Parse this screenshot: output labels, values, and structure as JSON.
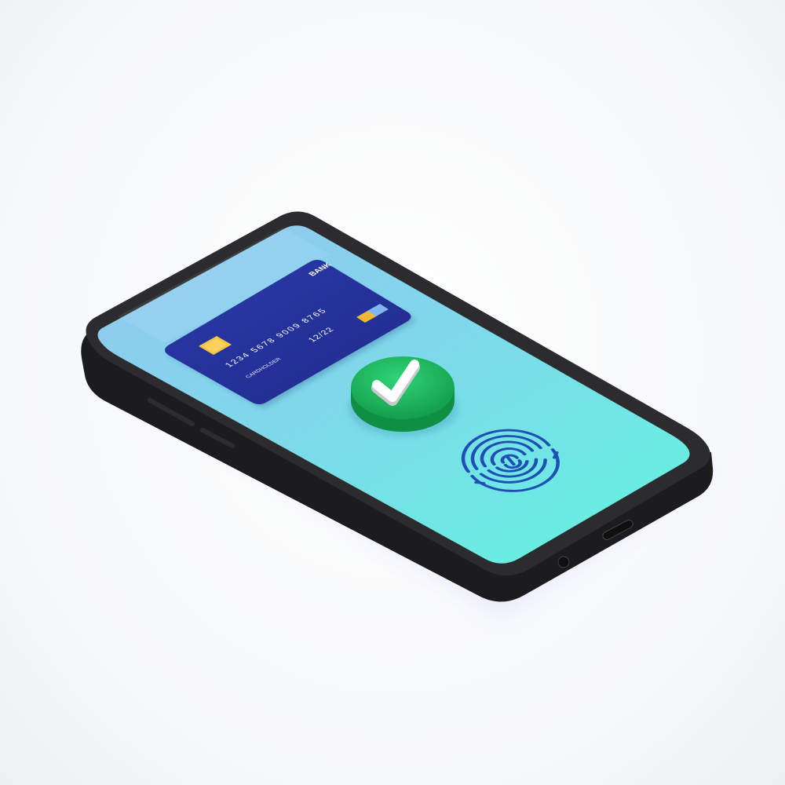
{
  "card": {
    "bank": "BANK",
    "number": "1234  5678  9009  8765",
    "expiry": "12/22",
    "holder": "CARDHOLDER"
  },
  "colors": {
    "phone_body": "#2b2b2d",
    "phone_edge": "#1b1b1c",
    "screen_top": "#8fc9ee",
    "screen_bottom": "#6ff0e4",
    "card_blue": "#28349c",
    "chip_yellow": "#f3c545",
    "check_green": "#18b45a",
    "fingerprint_blue": "#1f4fb3"
  },
  "icons": {
    "check": "check-icon",
    "fingerprint": "fingerprint-icon",
    "chip": "card-chip-icon",
    "contactless": "contactless-icon"
  }
}
